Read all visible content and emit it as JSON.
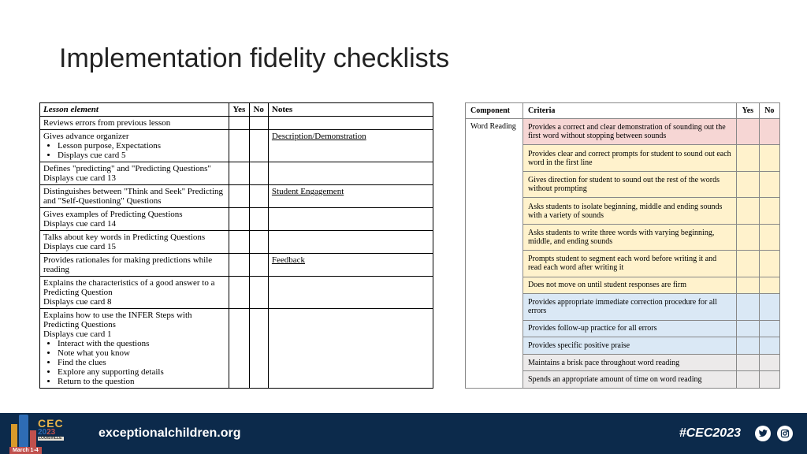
{
  "title": "Implementation fidelity checklists",
  "left": {
    "headers": [
      "Lesson element",
      "Yes",
      "No",
      "Notes"
    ],
    "rows": [
      {
        "element": "Reviews errors from previous lesson",
        "notes": ""
      },
      {
        "element": "Gives advance organizer",
        "bullets": [
          "Lesson purpose, Expectations",
          "Displays cue card 5"
        ],
        "notes": "Description/Demonstration"
      },
      {
        "element": "Defines \"predicting\" and \"Predicting Questions\"\nDisplays cue card 13",
        "notes": ""
      },
      {
        "element": "Distinguishes between \"Think and Seek\" Predicting and \"Self-Questioning\" Questions",
        "notes": "Student Engagement"
      },
      {
        "element": "Gives examples of Predicting Questions\nDisplays cue card 14",
        "notes": ""
      },
      {
        "element": "Talks about key words in Predicting Questions\nDisplays cue card 15",
        "notes": ""
      },
      {
        "element": "Provides rationales for making predictions while reading",
        "notes": "Feedback"
      },
      {
        "element": "Explains the characteristics of a good answer to a Predicting Question\nDisplays cue card 8",
        "notes": ""
      },
      {
        "element": "Explains how to use the INFER Steps with Predicting Questions\nDisplays cue card 1",
        "bullets": [
          "Interact with the questions",
          "Note what you know",
          "Find the clues",
          "Explore any supporting details",
          "Return to the question"
        ],
        "notes": ""
      }
    ]
  },
  "right": {
    "headers": [
      "Component",
      "Criteria",
      "Yes",
      "No"
    ],
    "component": "Word Reading",
    "rows": [
      {
        "crit": "Provides a correct and clear demonstration of sounding out the first word without stopping between sounds",
        "tone": "red"
      },
      {
        "crit": "Provides clear and correct prompts for student to sound out each word in the first line",
        "tone": "yel"
      },
      {
        "crit": "Gives direction for student to sound out the rest of the words without prompting",
        "tone": "yel"
      },
      {
        "crit": "Asks students to isolate beginning, middle and ending sounds with a variety of sounds",
        "tone": "yel"
      },
      {
        "crit": "Asks students to write three words with varying beginning, middle, and ending sounds",
        "tone": "yel"
      },
      {
        "crit": "Prompts student to segment each word before writing it and read each word after writing it",
        "tone": "yel"
      },
      {
        "crit": "Does not move on until student responses are firm",
        "tone": "yel"
      },
      {
        "crit": "Provides appropriate immediate correction procedure for all errors",
        "tone": "blue"
      },
      {
        "crit": "Provides follow-up practice for all errors",
        "tone": "blue"
      },
      {
        "crit": "Provides specific positive praise",
        "tone": "blue"
      },
      {
        "crit": "Maintains a brisk pace throughout word reading",
        "tone": "gray"
      },
      {
        "crit": "Spends an appropriate amount of time on word reading",
        "tone": "gray"
      }
    ]
  },
  "footer": {
    "url": "exceptionalchildren.org",
    "hashtag": "#CEC2023",
    "logo": {
      "cec": "CEC",
      "y20": "20",
      "y23": "23",
      "sub": "LOUISVILLE",
      "date": "March 1-4"
    }
  }
}
